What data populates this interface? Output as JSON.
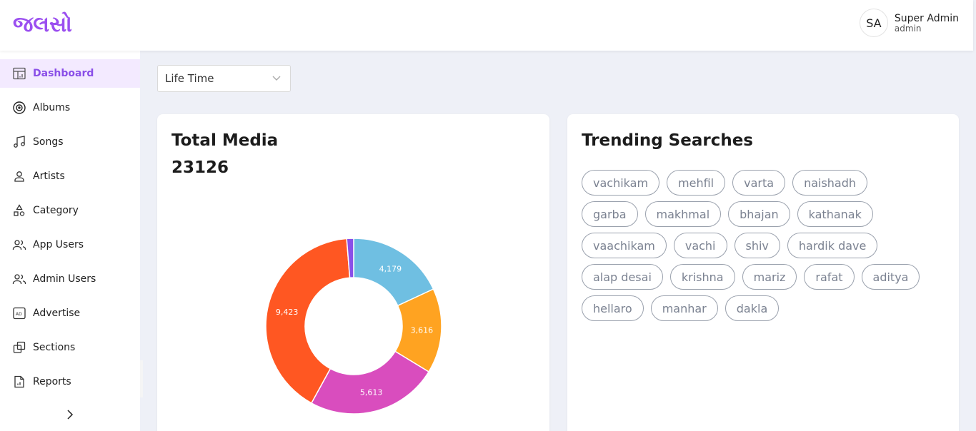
{
  "header": {
    "brand_text": "જલસો",
    "user": {
      "initials": "SA",
      "name": "Super Admin",
      "role": "admin"
    }
  },
  "sidebar": {
    "items": [
      {
        "label": "Dashboard",
        "icon": "dashboard-icon",
        "active": true
      },
      {
        "label": "Albums",
        "icon": "disc-icon"
      },
      {
        "label": "Songs",
        "icon": "music-note-icon"
      },
      {
        "label": "Artists",
        "icon": "person-icon"
      },
      {
        "label": "Category",
        "icon": "shapes-icon"
      },
      {
        "label": "App Users",
        "icon": "users-icon"
      },
      {
        "label": "Admin Users",
        "icon": "admin-users-icon"
      },
      {
        "label": "Advertise",
        "icon": "ad-icon"
      },
      {
        "label": "Sections",
        "icon": "sections-icon"
      },
      {
        "label": "Reports",
        "icon": "report-icon"
      }
    ],
    "collapse_icon": "chevron-right-icon"
  },
  "filter": {
    "value": "Life Time"
  },
  "total_media": {
    "title": "Total Media",
    "total": "23126"
  },
  "trending": {
    "title": "Trending Searches",
    "rows": [
      [
        "vachikam",
        "mehfil",
        "varta",
        "naishadh"
      ],
      [
        "garba",
        "makhmal",
        "bhajan",
        "kathanak"
      ],
      [
        "vaachikam",
        "vachi",
        "shiv",
        "hardik dave"
      ],
      [
        "alap desai",
        "krishna",
        "mariz",
        "rafat",
        "aditya"
      ],
      [
        "hellaro",
        "manhar",
        "dakla"
      ]
    ]
  },
  "colors": {
    "accent": "#8a4fe8",
    "slice_blue": "#6fbfe2",
    "slice_orange": "#ffa321",
    "slice_magenta": "#d94dbe",
    "slice_red": "#ff5722",
    "slice_purple": "#8a4fe8"
  },
  "chart_data": {
    "type": "pie",
    "variant": "donut",
    "slices": [
      {
        "value": 4179,
        "label": "4,179",
        "color": "#6fbfe2"
      },
      {
        "value": 3616,
        "label": "3,616",
        "color": "#ffa321"
      },
      {
        "value": 5613,
        "label": "5,613",
        "color": "#d94dbe"
      },
      {
        "value": 9423,
        "label": "9,423",
        "color": "#ff5722"
      },
      {
        "value": 295,
        "label": "",
        "color": "#8a4fe8"
      }
    ]
  }
}
